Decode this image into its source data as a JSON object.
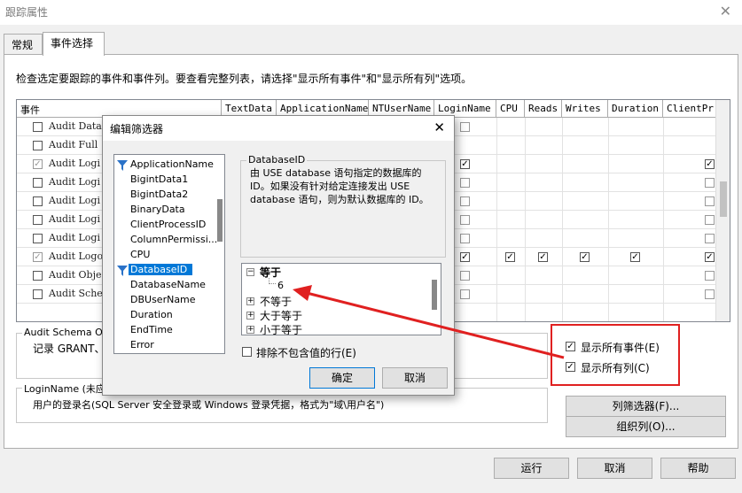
{
  "window": {
    "title": "跟踪属性",
    "close": "✕"
  },
  "tabs": [
    {
      "label": "常规"
    },
    {
      "label": "事件选择"
    }
  ],
  "hint": "检查选定要跟踪的事件和事件列。要查看完整列表，请选择\"显示所有事件\"和\"显示所有列\"选项。",
  "grid": {
    "columns": [
      "事件",
      "TextData",
      "ApplicationName",
      "NTUserName",
      "LoginName",
      "CPU",
      "Reads",
      "Writes",
      "Duration",
      "ClientPr"
    ],
    "rows": [
      {
        "name": "Audit Datab",
        "checked": false
      },
      {
        "name": "Audit Full",
        "checked": false
      },
      {
        "name": "Audit Logi",
        "checked": true
      },
      {
        "name": "Audit Logi",
        "checked": false
      },
      {
        "name": "Audit Logi",
        "checked": false
      },
      {
        "name": "Audit Logi",
        "checked": false
      },
      {
        "name": "Audit Logi",
        "checked": false
      },
      {
        "name": "Audit Logo",
        "checked": true
      },
      {
        "name": "Audit Obje",
        "checked": false
      },
      {
        "name": "Audit Sche",
        "checked": false
      }
    ]
  },
  "desc_event": {
    "title": "Audit Schema Obje",
    "text": "记录 GRANT、"
  },
  "desc_column": {
    "title": "LoginName (未应用",
    "text": "用户的登录名(SQL Server 安全登录或 Windows 登录凭据，格式为\"域\\用户名\")"
  },
  "options": {
    "show_all_events": "显示所有事件(E)",
    "show_all_columns": "显示所有列(C)"
  },
  "buttons": {
    "column_filter": "列筛选器(F)...",
    "organize_columns": "组织列(O)...",
    "run": "运行",
    "cancel": "取消",
    "help": "帮助"
  },
  "dialog": {
    "title": "编辑筛选器",
    "close": "✕",
    "columns": [
      "ApplicationName",
      "BigintData1",
      "BigintData2",
      "BinaryData",
      "ClientProcessID",
      "ColumnPermissi...",
      "CPU",
      "DatabaseID",
      "DatabaseName",
      "DBUserName",
      "Duration",
      "EndTime",
      "Error"
    ],
    "filtered": [
      "ApplicationName",
      "DatabaseID"
    ],
    "selected": "DatabaseID",
    "desc_title": "DatabaseID",
    "desc_text": "由 USE database 语句指定的数据库的 ID。如果没有针对给定连接发出 USE database 语句，则为默认数据库的 ID。",
    "tree": [
      {
        "op": "等于",
        "value": "6"
      },
      {
        "op": "不等于"
      },
      {
        "op": "大于等于"
      },
      {
        "op": "小于等于"
      }
    ],
    "exclude_label": "排除不包含值的行(E)",
    "ok": "确定",
    "cancel": "取消"
  },
  "colors": {
    "highlight": "#e02020",
    "selection": "#0078d7"
  }
}
